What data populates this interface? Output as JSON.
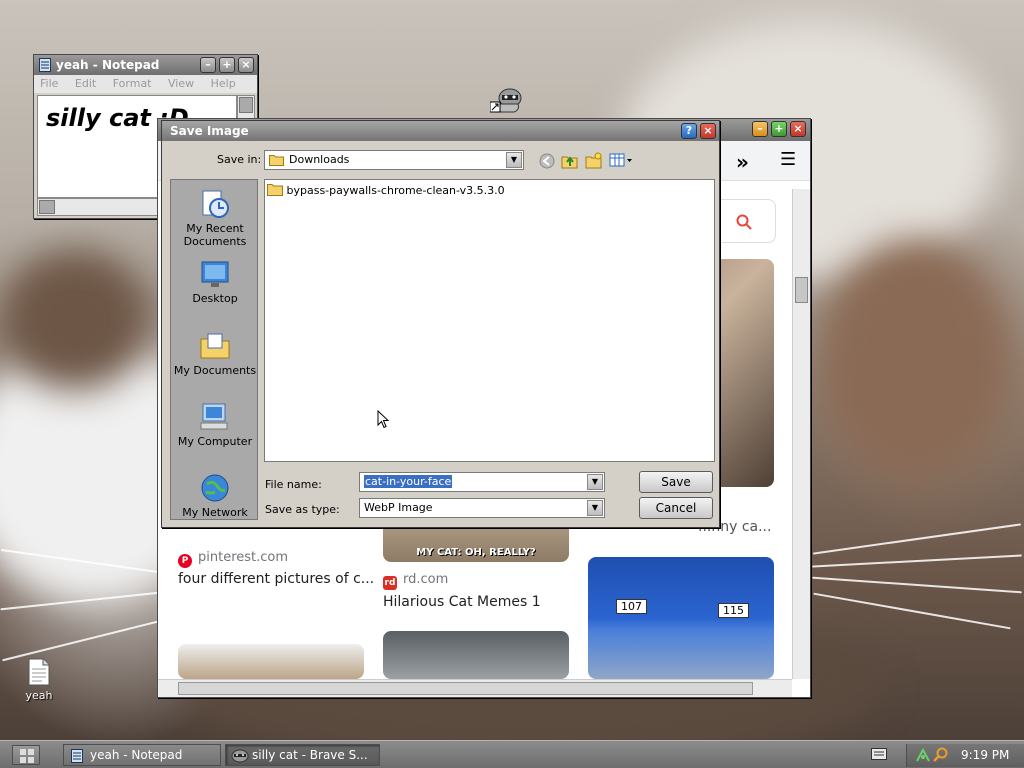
{
  "desktop": {
    "icons": [
      {
        "label": "yeah",
        "icon": "text-file-icon"
      }
    ],
    "shortcut_icon": "raccoon-shortcut-icon"
  },
  "notepad": {
    "title": "yeah - Notepad",
    "menu": [
      "File",
      "Edit",
      "Format",
      "View",
      "Help"
    ],
    "content": "silly cat :D"
  },
  "browser": {
    "title": "silly cat - Brave S...",
    "toolbar": {
      "overflow": "»",
      "menu": "☰"
    },
    "results": [
      {
        "source": "pinterest.com",
        "caption": "four different pictures of c...",
        "favicon_color": "#e60023"
      },
      {
        "source": "rd.com",
        "caption": "Hilarious Cat Memes 1",
        "meme_text": "MY CAT: OH, REALLY?",
        "favicon_color": "#d93025"
      },
      {
        "source": "",
        "caption": "...nny ca..."
      }
    ],
    "cage_tags": [
      "107",
      "115"
    ]
  },
  "dialog": {
    "title": "Save Image",
    "save_in_label": "Save in:",
    "save_in_value": "Downloads",
    "places": [
      {
        "label": "My Recent Documents",
        "icon": "recent-documents-icon"
      },
      {
        "label": "Desktop",
        "icon": "desktop-icon"
      },
      {
        "label": "My Documents",
        "icon": "my-documents-icon"
      },
      {
        "label": "My Computer",
        "icon": "my-computer-icon"
      },
      {
        "label": "My Network",
        "icon": "my-network-icon"
      }
    ],
    "files": [
      {
        "name": "bypass-paywalls-chrome-clean-v3.5.3.0",
        "icon": "folder-icon"
      }
    ],
    "file_name_label": "File name:",
    "file_name_value": "cat-in-your-face",
    "save_type_label": "Save as type:",
    "save_type_value": "WebP Image",
    "save_button": "Save",
    "cancel_button": "Cancel"
  },
  "taskbar": {
    "tasks": [
      {
        "label": "yeah - Notepad",
        "icon": "notepad-icon"
      },
      {
        "label": "silly cat - Brave S...",
        "icon": "raccoon-icon"
      }
    ],
    "clock": "9:19 PM"
  }
}
